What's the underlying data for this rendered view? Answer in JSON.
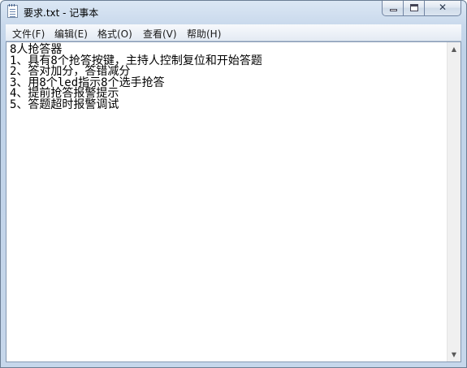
{
  "window": {
    "title": "要求.txt - 记事本",
    "icon": "notepad-icon"
  },
  "caption": {
    "minimize_icon": "minimize-icon",
    "maximize_icon": "maximize-icon",
    "close_icon": "close-icon",
    "close_glyph": "✕"
  },
  "menu": {
    "items": [
      {
        "label": "文件(F)"
      },
      {
        "label": "编辑(E)"
      },
      {
        "label": "格式(O)"
      },
      {
        "label": "查看(V)"
      },
      {
        "label": "帮助(H)"
      }
    ]
  },
  "document": {
    "lines": [
      "8人抢答器",
      "1、具有8个抢答按键，主持人控制复位和开始答题",
      "2、答对加分，答错减分",
      "3、用8个led指示8个选手抢答",
      "4、提前抢答报警提示",
      "5、答题超时报警调试"
    ]
  },
  "scrollbar": {
    "up_glyph": "▲",
    "down_glyph": "▼"
  },
  "colors": {
    "frame": "#c9d9ec",
    "text": "#000000",
    "menu_bg": "#eef2f8"
  }
}
